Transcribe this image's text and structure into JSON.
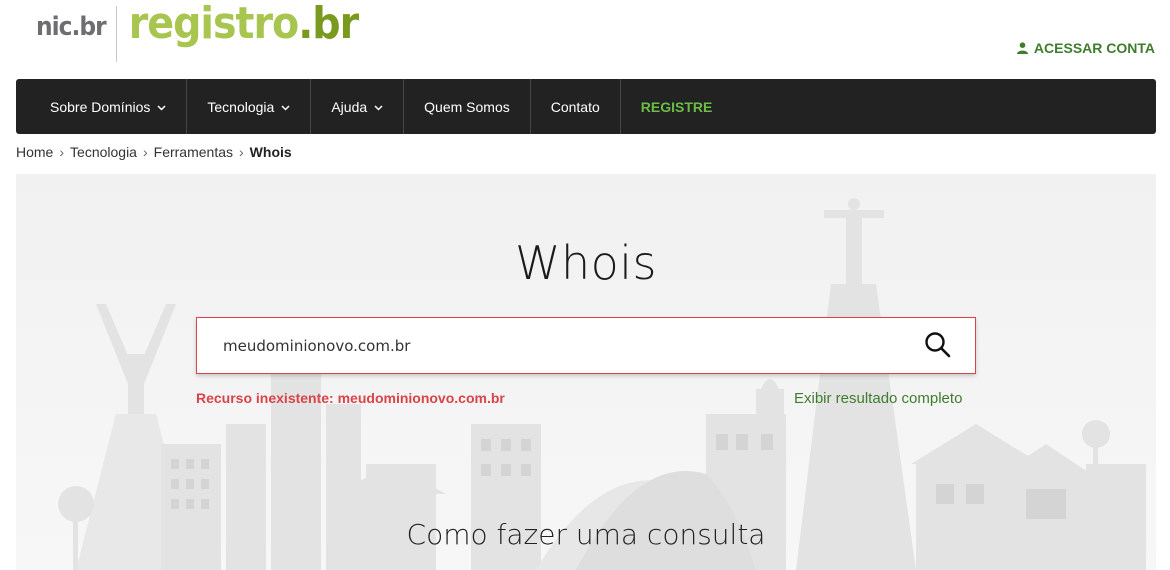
{
  "brand": {
    "nic_label": "nic.br",
    "registro_label": "registro",
    "registro_suffix": ".br",
    "accent_color": "#a7c54f"
  },
  "header": {
    "account_label": "ACESSAR CONTA",
    "account_icon": "user-icon"
  },
  "nav": {
    "items": [
      {
        "label": "Sobre Domínios",
        "has_dropdown": true
      },
      {
        "label": "Tecnologia",
        "has_dropdown": true
      },
      {
        "label": "Ajuda",
        "has_dropdown": true
      },
      {
        "label": "Quem Somos",
        "has_dropdown": false
      },
      {
        "label": "Contato",
        "has_dropdown": false
      },
      {
        "label": "REGISTRE",
        "has_dropdown": false
      }
    ],
    "dropdown_icon": "chevron-down-icon",
    "background_color": "#222222",
    "highlight_color": "#6bbd45"
  },
  "breadcrumb": {
    "items": [
      "Home",
      "Tecnologia",
      "Ferramentas"
    ],
    "current": "Whois",
    "separator": "›"
  },
  "hero": {
    "title": "Whois",
    "search": {
      "value": "meudominionovo.com.br",
      "icon": "search-icon"
    },
    "error_message": "Recurso inexistente: meudominionovo.com.br",
    "full_result_link": "Exibir resultado completo",
    "section_title": "Como fazer uma consulta",
    "error_color": "#d9444a",
    "link_color": "#3f7d2e"
  }
}
